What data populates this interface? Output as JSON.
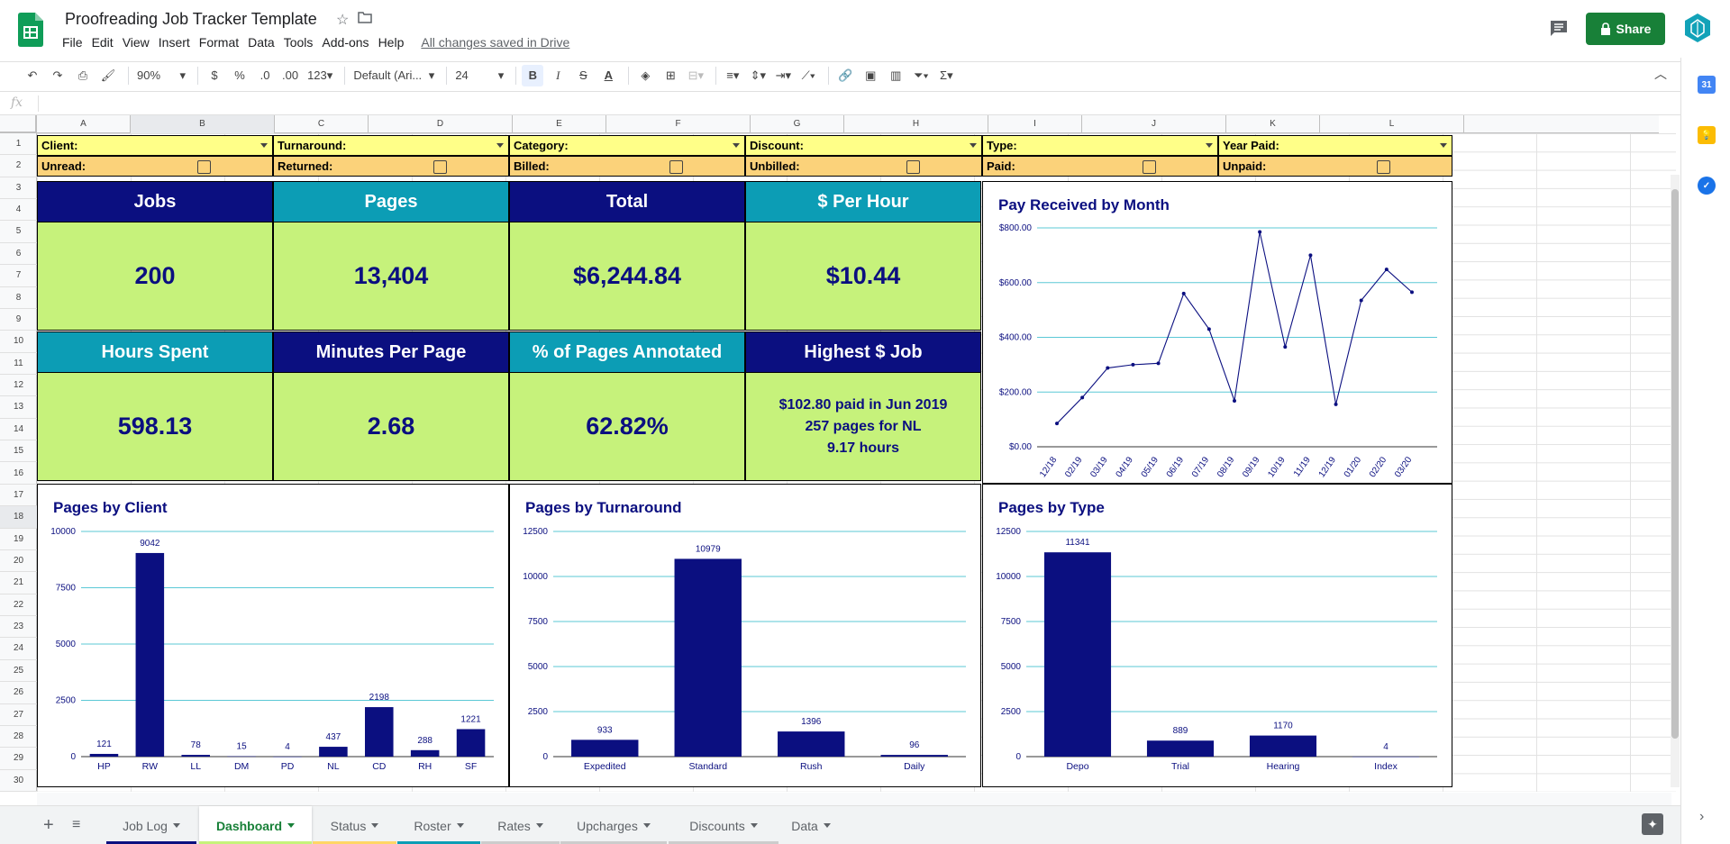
{
  "app": {
    "title": "Proofreading Job Tracker Template",
    "saved_status": "All changes saved in Drive",
    "share_label": "Share",
    "menu": [
      "File",
      "Edit",
      "View",
      "Insert",
      "Format",
      "Data",
      "Tools",
      "Add-ons",
      "Help"
    ]
  },
  "toolbar": {
    "zoom": "90%",
    "currency": "$",
    "percent": "%",
    "dec_decrease": ".0",
    "dec_increase": ".00",
    "more_formats": "123",
    "font": "Default (Ari...",
    "font_size": "24",
    "bold": "B",
    "italic": "I",
    "strike": "S",
    "text_color": "A",
    "sum": "Σ"
  },
  "formula": {
    "fx": "fx"
  },
  "grid": {
    "columns": [
      "A",
      "B",
      "C",
      "D",
      "E",
      "F",
      "G",
      "H",
      "I",
      "J",
      "K",
      "L"
    ],
    "selected_column": "B",
    "rows": [
      "1",
      "2",
      "3",
      "4",
      "5",
      "6",
      "7",
      "8",
      "9",
      "10",
      "11",
      "12",
      "13",
      "14",
      "15",
      "16",
      "17",
      "18",
      "19",
      "20",
      "21",
      "22",
      "23",
      "24",
      "25",
      "26",
      "27",
      "28",
      "29",
      "30"
    ],
    "selected_row": "18"
  },
  "filters": {
    "row1": [
      "Client:",
      "Turnaround:",
      "Category:",
      "Discount:",
      "Type:",
      "Year Paid:"
    ],
    "row2": [
      "Unread:",
      "Returned:",
      "Billed:",
      "Unbilled:",
      "Paid:",
      "Unpaid:"
    ]
  },
  "kpis": {
    "jobs": {
      "label": "Jobs",
      "value": "200"
    },
    "pages": {
      "label": "Pages",
      "value": "13,404"
    },
    "total": {
      "label": "Total",
      "value": "$6,244.84"
    },
    "per_hour": {
      "label": "$ Per Hour",
      "value": "$10.44"
    },
    "hours": {
      "label": "Hours Spent",
      "value": "598.13"
    },
    "min_per_page": {
      "label": "Minutes Per Page",
      "value": "2.68"
    },
    "annotated": {
      "label": "% of Pages Annotated",
      "value": "62.82%"
    },
    "highest": {
      "label": "Highest $ Job",
      "line1": "$102.80 paid in Jun 2019",
      "line2": "257 pages for NL",
      "line3": "9.17 hours"
    }
  },
  "colors": {
    "navy": "#0b0f80",
    "teal": "#0c9db5",
    "kpi_bg": "#c6f27b",
    "filter_yellow": "#ffff88",
    "filter_orange": "#fbd27a",
    "share_green": "#188038",
    "grid_line": "#5bc8d6"
  },
  "chart_data": [
    {
      "type": "line",
      "title": "Pay Received by Month",
      "x": [
        "12/18",
        "02/19",
        "03/19",
        "04/19",
        "05/19",
        "06/19",
        "07/19",
        "08/19",
        "09/19",
        "10/19",
        "11/19",
        "12/19",
        "01/20",
        "02/20",
        "03/20"
      ],
      "y": [
        85,
        180,
        288,
        300,
        305,
        560,
        430,
        168,
        785,
        365,
        700,
        155,
        535,
        648,
        565
      ],
      "yticks": [
        "$0.00",
        "$200.00",
        "$400.00",
        "$600.00",
        "$800.00"
      ],
      "ylim": [
        0,
        800
      ],
      "grid": true
    },
    {
      "type": "bar",
      "title": "Pages by Client",
      "categories": [
        "HP",
        "RW",
        "LL",
        "DM",
        "PD",
        "NL",
        "CD",
        "RH",
        "SF"
      ],
      "values": [
        121,
        9042,
        78,
        15,
        4,
        437,
        2198,
        288,
        1221
      ],
      "yticks": [
        "0",
        "2500",
        "5000",
        "7500",
        "10000"
      ],
      "ylim": [
        0,
        10000
      ],
      "grid": true
    },
    {
      "type": "bar",
      "title": "Pages by Turnaround",
      "categories": [
        "Expedited",
        "Standard",
        "Rush",
        "Daily"
      ],
      "values": [
        933,
        10979,
        1396,
        96
      ],
      "yticks": [
        "0",
        "2500",
        "5000",
        "7500",
        "10000",
        "12500"
      ],
      "ylim": [
        0,
        12500
      ],
      "grid": true
    },
    {
      "type": "bar",
      "title": "Pages by Type",
      "categories": [
        "Depo",
        "Trial",
        "Hearing",
        "Index"
      ],
      "values": [
        11341,
        889,
        1170,
        4
      ],
      "yticks": [
        "0",
        "2500",
        "5000",
        "7500",
        "10000",
        "12500"
      ],
      "ylim": [
        0,
        12500
      ],
      "grid": true
    }
  ],
  "sheets": [
    {
      "label": "Job Log",
      "color": "#0b0f80"
    },
    {
      "label": "Dashboard",
      "color": "#c6f27b"
    },
    {
      "label": "Status",
      "color": "#ffd666"
    },
    {
      "label": "Roster",
      "color": "#0c9db5"
    },
    {
      "label": "Rates",
      "color": "#cccccc"
    },
    {
      "label": "Upcharges",
      "color": "#cccccc"
    },
    {
      "label": "Discounts",
      "color": "#cccccc"
    },
    {
      "label": "Data",
      "color": ""
    }
  ],
  "active_sheet": "Dashboard"
}
